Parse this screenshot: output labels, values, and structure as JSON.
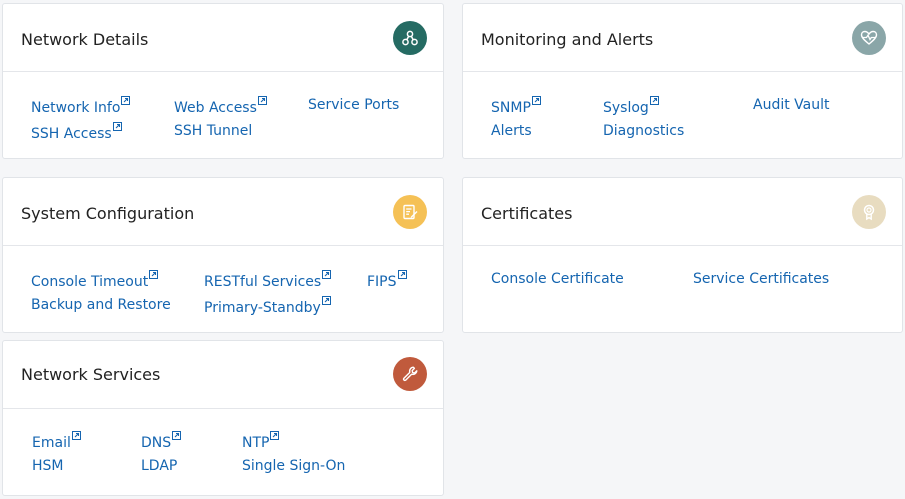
{
  "cards": {
    "network_details": {
      "title": "Network Details",
      "icon": "network-nodes-icon",
      "icon_color": "#256b63",
      "links": {
        "network_info": "Network Info",
        "web_access": "Web Access",
        "service_ports": "Service Ports",
        "ssh_access": "SSH Access",
        "ssh_tunnel": "SSH Tunnel"
      }
    },
    "monitoring_alerts": {
      "title": "Monitoring and Alerts",
      "icon": "heart-pulse-icon",
      "icon_color": "#8aa6a8",
      "links": {
        "snmp": "SNMP",
        "syslog": "Syslog",
        "audit_vault": "Audit Vault",
        "alerts": "Alerts",
        "diagnostics": "Diagnostics"
      }
    },
    "system_configuration": {
      "title": "System Configuration",
      "icon": "config-document-icon",
      "icon_color": "#f5c156",
      "links": {
        "console_timeout": "Console Timeout",
        "restful_services": "RESTful Services",
        "fips": "FIPS",
        "backup_restore": "Backup and Restore",
        "primary_standby": "Primary-Standby"
      }
    },
    "certificates": {
      "title": "Certificates",
      "icon": "certificate-award-icon",
      "icon_color": "#e8dcc0",
      "links": {
        "console_certificate": "Console Certificate",
        "service_certificates": "Service Certificates"
      }
    },
    "network_services": {
      "title": "Network Services",
      "icon": "wrench-icon",
      "icon_color": "#c05a3c",
      "links": {
        "email": "Email",
        "dns": "DNS",
        "ntp": "NTP",
        "hsm": "HSM",
        "ldap": "LDAP",
        "single_sign_on": "Single Sign-On"
      }
    }
  },
  "colors": {
    "link": "#1565b0",
    "card_border": "#e1e4e8",
    "background": "#f5f6f8"
  }
}
